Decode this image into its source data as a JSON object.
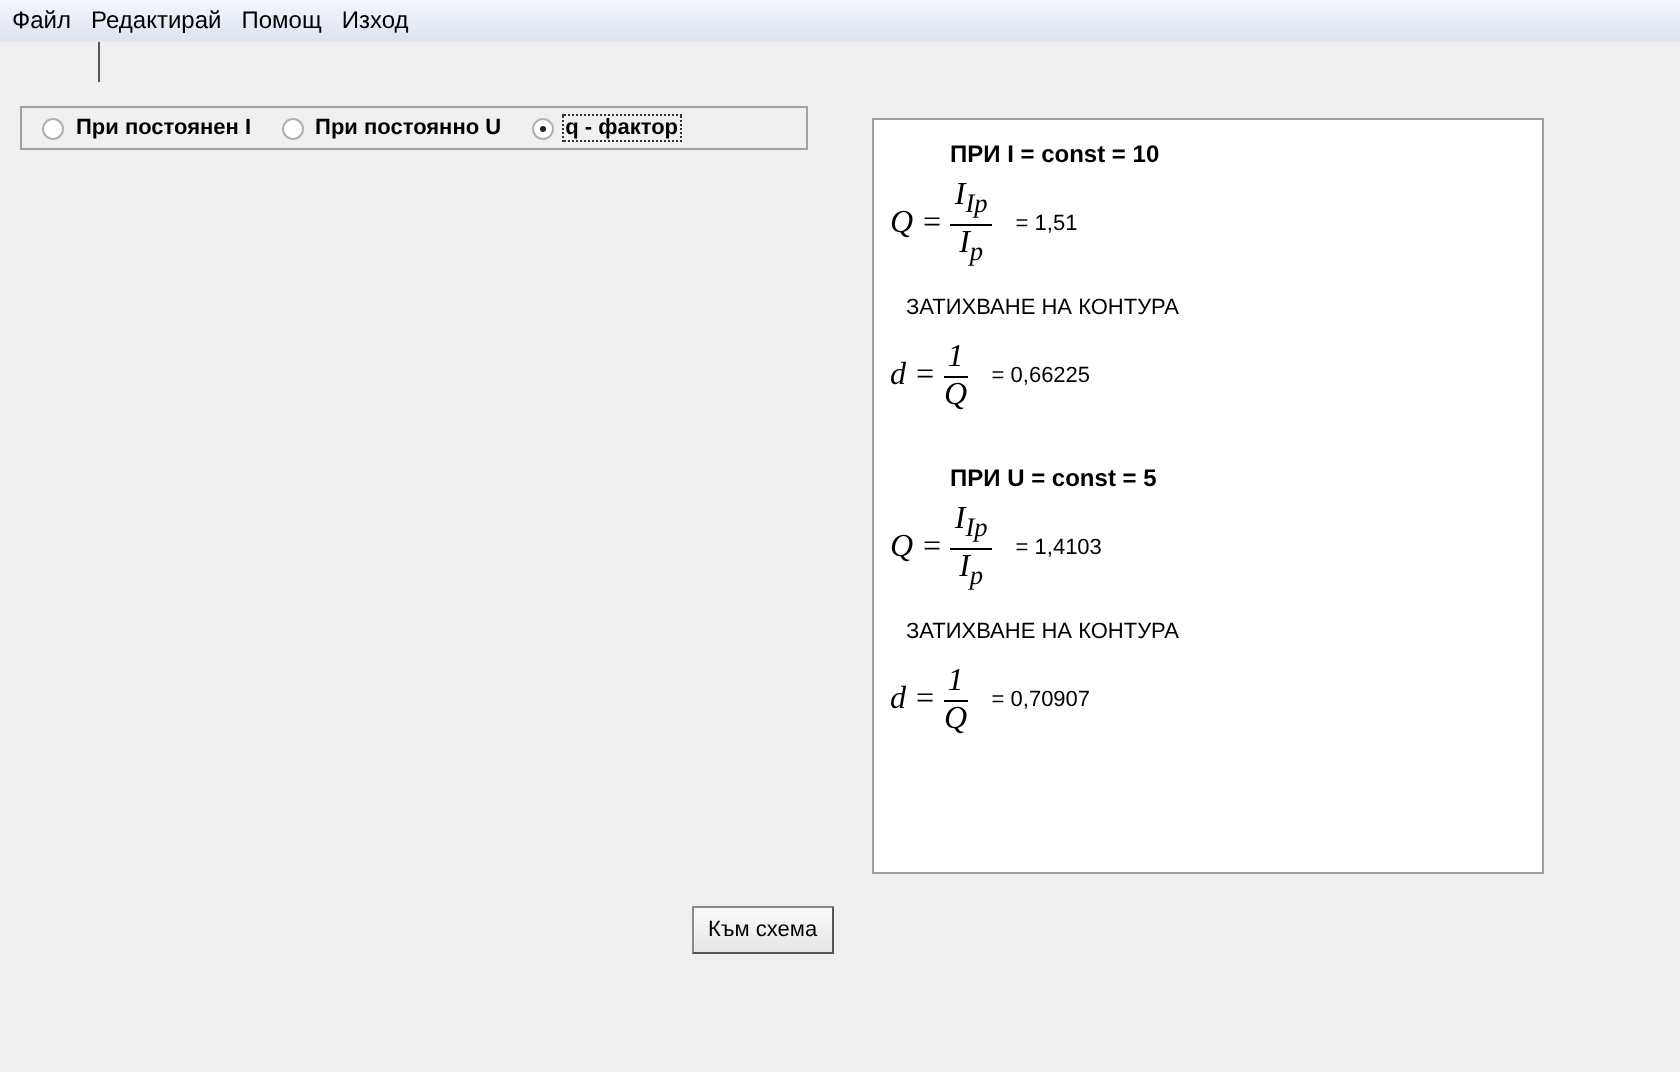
{
  "menu": [
    "Файл",
    "Редактирай",
    "Помощ",
    "Изход"
  ],
  "modes": [
    {
      "label": "При постоянен I",
      "selected": false
    },
    {
      "label": "При постоянно U",
      "selected": false
    },
    {
      "label": "q - фактор",
      "selected": true
    }
  ],
  "results": [
    {
      "heading": "ПРИ I = const = 10",
      "q": {
        "lhs": "Q =",
        "numerator": "I$_{Iр}$",
        "denominator": "I$_{р}$",
        "result": "=  1,51"
      },
      "caption": "ЗАТИХВАНЕ НА КОНТУРА",
      "d": {
        "lhs": "d =",
        "numerator": "1",
        "denominator": "Q",
        "result": "=  0,66225"
      }
    },
    {
      "heading": "ПРИ U = const = 5",
      "q": {
        "lhs": "Q =",
        "numerator": "I$_{Iр}$",
        "denominator": "I$_{р}$",
        "result": "=  1,4103"
      },
      "caption": "ЗАТИХВАНЕ НА КОНТУРА",
      "d": {
        "lhs": "d =",
        "numerator": "1",
        "denominator": "Q",
        "result": "=  0,70907"
      }
    }
  ],
  "button": "Към схема"
}
